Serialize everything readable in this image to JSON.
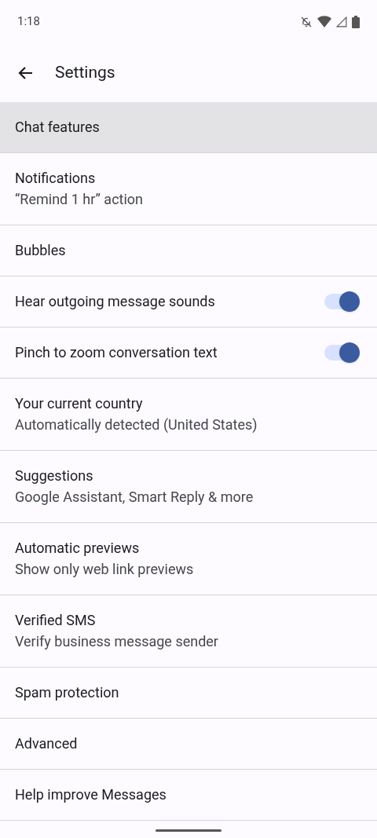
{
  "status_bar": {
    "time": "1:18"
  },
  "app_bar": {
    "title": "Settings"
  },
  "items": [
    {
      "title": "Chat features",
      "selected": true
    },
    {
      "title": "Notifications",
      "subtitle": "“Remind 1 hr” action",
      "selected": false
    },
    {
      "title": "Bubbles",
      "selected": false
    },
    {
      "title": "Hear outgoing message sounds",
      "kind": "switch",
      "on": true,
      "selected": false
    },
    {
      "title": "Pinch to zoom conversation text",
      "kind": "switch",
      "on": true,
      "selected": false
    },
    {
      "title": "Your current country",
      "subtitle": "Automatically detected (United States)",
      "selected": false
    },
    {
      "title": "Suggestions",
      "subtitle": "Google Assistant, Smart Reply & more",
      "selected": false
    },
    {
      "title": "Automatic previews",
      "subtitle": "Show only web link previews",
      "selected": false
    },
    {
      "title": "Verified SMS",
      "subtitle": "Verify business message sender",
      "selected": false
    },
    {
      "title": "Spam protection",
      "selected": false
    },
    {
      "title": "Advanced",
      "selected": false
    },
    {
      "title": "Help improve Messages",
      "selected": false
    }
  ]
}
